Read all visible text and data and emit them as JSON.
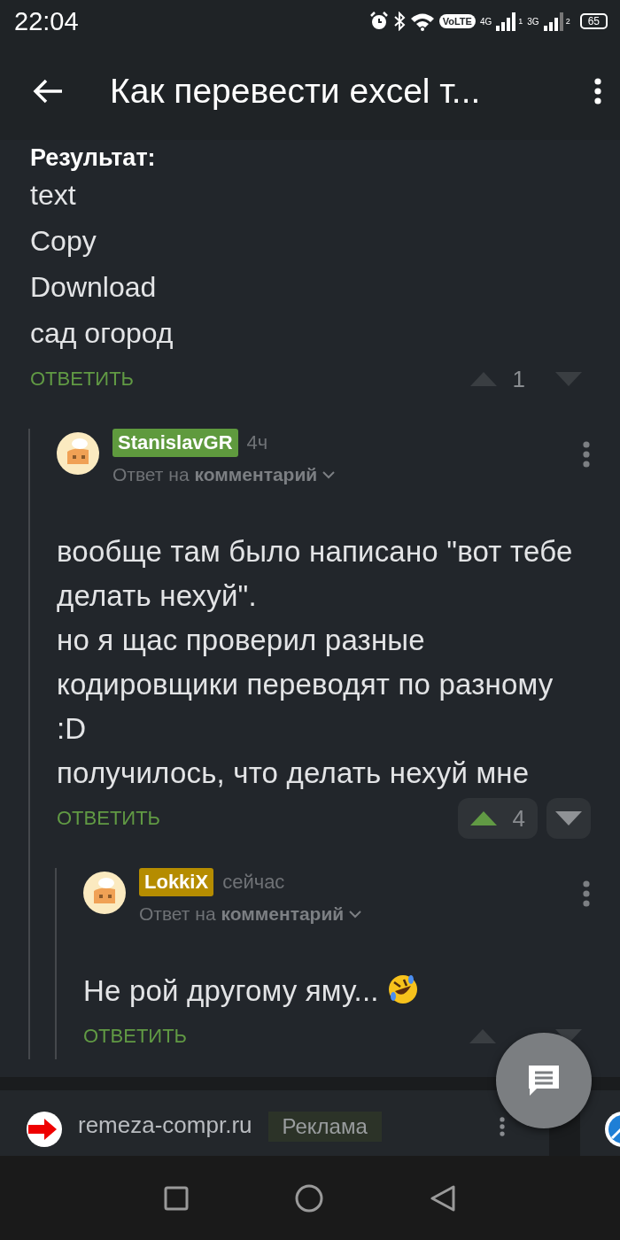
{
  "status_bar": {
    "time": "22:04",
    "volte": "VoLTE",
    "network_1": "4G",
    "sim_1": "1",
    "network_2": "3G",
    "sim_2": "2",
    "battery": "65"
  },
  "app_bar": {
    "title": "Как перевести excel т..."
  },
  "thread": {
    "heading": "Результат:",
    "lines": [
      "text",
      "Copy",
      "Download",
      "сад огород"
    ],
    "reply_label": "ОТВЕТИТЬ",
    "score": "1",
    "upvoted": false,
    "children": [
      {
        "author": "StanislavGR",
        "color": "#5f9a3e",
        "time": "4ч",
        "reply_prefix": "Ответ на",
        "reply_link": "комментарий",
        "lines": [
          "вообще там было написано \"вот тебе делать нехуй\".",
          "но я щас проверил разные кодировщики переводят по разному :D",
          "получилось, что делать нехуй мне"
        ],
        "reply_label": "ОТВЕТИТЬ",
        "score": "4",
        "upvoted": true,
        "children": [
          {
            "author": "LokkiX",
            "color": "#b58c00",
            "time": "сейчас",
            "reply_prefix": "Ответ на",
            "reply_link": "комментарий",
            "lines": [
              "Не рой другому яму..."
            ],
            "emoji": true,
            "reply_label": "ОТВЕТИТЬ",
            "upvoted": false
          }
        ]
      }
    ]
  },
  "ad": {
    "domain": "remeza-compr.ru",
    "badge": "Реклама"
  }
}
